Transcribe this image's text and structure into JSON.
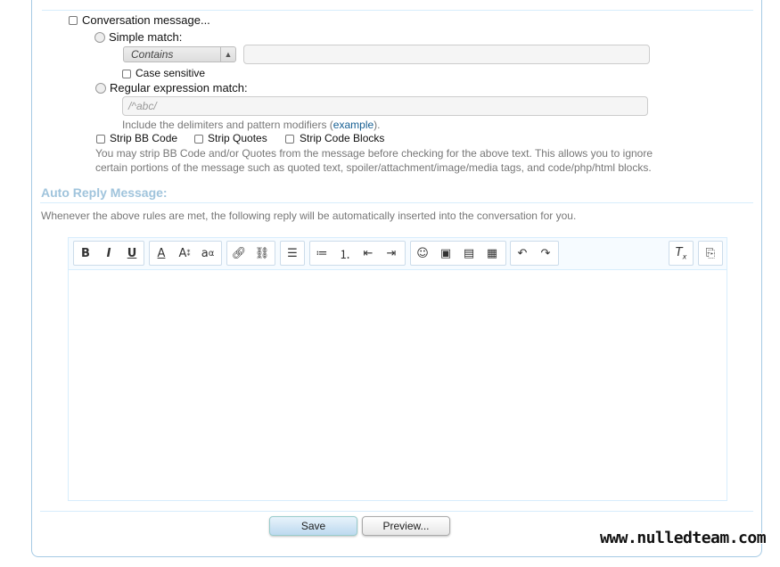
{
  "conversation_message": {
    "label": "Conversation message...",
    "simple_match": {
      "label": "Simple match:",
      "select_value": "Contains",
      "case_sensitive_label": "Case sensitive"
    },
    "regex_match": {
      "label": "Regular expression match:",
      "placeholder": "/^abc/",
      "hint_prefix": "Include the delimiters and pattern modifiers (",
      "hint_link": "example",
      "hint_suffix": ")."
    },
    "strip": {
      "bb_code": "Strip BB Code",
      "quotes": "Strip Quotes",
      "code_blocks": "Strip Code Blocks",
      "hint_line1": "You may strip BB Code and/or Quotes from the message before checking for the above text. This allows you to ignore",
      "hint_line2": "certain portions of the message such as quoted text, spoiler/attachment/image/media tags, and code/php/html blocks."
    }
  },
  "auto_reply": {
    "title": "Auto Reply Message:",
    "description": "Whenever the above rules are met, the following reply will be automatically inserted into the conversation for you."
  },
  "toolbar": {
    "bold": "B",
    "italic": "I",
    "underline": "U",
    "font_color": "A",
    "font_size": "A",
    "font_family": "a",
    "link": "link-icon",
    "unlink": "unlink-icon",
    "align": "align-left-icon",
    "bullet_list": "bullet-list-icon",
    "number_list": "number-list-icon",
    "outdent": "outdent-icon",
    "indent": "indent-icon",
    "smilie": "smilie-icon",
    "image": "image-icon",
    "media": "media-icon",
    "code": "code-icon",
    "undo": "undo-icon",
    "redo": "redo-icon",
    "remove_format": "remove-format-icon",
    "toggle_bbcode": "toggle-bbcode-icon"
  },
  "buttons": {
    "save": "Save",
    "preview": "Preview..."
  },
  "watermark": "www.nulledteam.com"
}
